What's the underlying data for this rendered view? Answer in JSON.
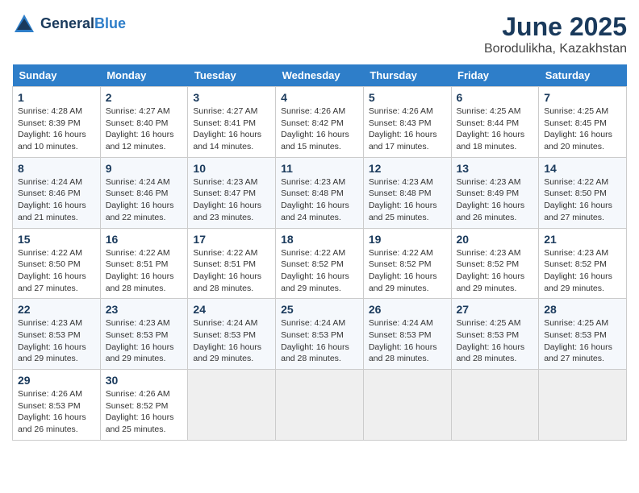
{
  "header": {
    "logo_line1": "General",
    "logo_line2": "Blue",
    "month_title": "June 2025",
    "location": "Borodulikha, Kazakhstan"
  },
  "weekdays": [
    "Sunday",
    "Monday",
    "Tuesday",
    "Wednesday",
    "Thursday",
    "Friday",
    "Saturday"
  ],
  "weeks": [
    [
      {
        "day": "1",
        "info": "Sunrise: 4:28 AM\nSunset: 8:39 PM\nDaylight: 16 hours\nand 10 minutes."
      },
      {
        "day": "2",
        "info": "Sunrise: 4:27 AM\nSunset: 8:40 PM\nDaylight: 16 hours\nand 12 minutes."
      },
      {
        "day": "3",
        "info": "Sunrise: 4:27 AM\nSunset: 8:41 PM\nDaylight: 16 hours\nand 14 minutes."
      },
      {
        "day": "4",
        "info": "Sunrise: 4:26 AM\nSunset: 8:42 PM\nDaylight: 16 hours\nand 15 minutes."
      },
      {
        "day": "5",
        "info": "Sunrise: 4:26 AM\nSunset: 8:43 PM\nDaylight: 16 hours\nand 17 minutes."
      },
      {
        "day": "6",
        "info": "Sunrise: 4:25 AM\nSunset: 8:44 PM\nDaylight: 16 hours\nand 18 minutes."
      },
      {
        "day": "7",
        "info": "Sunrise: 4:25 AM\nSunset: 8:45 PM\nDaylight: 16 hours\nand 20 minutes."
      }
    ],
    [
      {
        "day": "8",
        "info": "Sunrise: 4:24 AM\nSunset: 8:46 PM\nDaylight: 16 hours\nand 21 minutes."
      },
      {
        "day": "9",
        "info": "Sunrise: 4:24 AM\nSunset: 8:46 PM\nDaylight: 16 hours\nand 22 minutes."
      },
      {
        "day": "10",
        "info": "Sunrise: 4:23 AM\nSunset: 8:47 PM\nDaylight: 16 hours\nand 23 minutes."
      },
      {
        "day": "11",
        "info": "Sunrise: 4:23 AM\nSunset: 8:48 PM\nDaylight: 16 hours\nand 24 minutes."
      },
      {
        "day": "12",
        "info": "Sunrise: 4:23 AM\nSunset: 8:48 PM\nDaylight: 16 hours\nand 25 minutes."
      },
      {
        "day": "13",
        "info": "Sunrise: 4:23 AM\nSunset: 8:49 PM\nDaylight: 16 hours\nand 26 minutes."
      },
      {
        "day": "14",
        "info": "Sunrise: 4:22 AM\nSunset: 8:50 PM\nDaylight: 16 hours\nand 27 minutes."
      }
    ],
    [
      {
        "day": "15",
        "info": "Sunrise: 4:22 AM\nSunset: 8:50 PM\nDaylight: 16 hours\nand 27 minutes."
      },
      {
        "day": "16",
        "info": "Sunrise: 4:22 AM\nSunset: 8:51 PM\nDaylight: 16 hours\nand 28 minutes."
      },
      {
        "day": "17",
        "info": "Sunrise: 4:22 AM\nSunset: 8:51 PM\nDaylight: 16 hours\nand 28 minutes."
      },
      {
        "day": "18",
        "info": "Sunrise: 4:22 AM\nSunset: 8:52 PM\nDaylight: 16 hours\nand 29 minutes."
      },
      {
        "day": "19",
        "info": "Sunrise: 4:22 AM\nSunset: 8:52 PM\nDaylight: 16 hours\nand 29 minutes."
      },
      {
        "day": "20",
        "info": "Sunrise: 4:23 AM\nSunset: 8:52 PM\nDaylight: 16 hours\nand 29 minutes."
      },
      {
        "day": "21",
        "info": "Sunrise: 4:23 AM\nSunset: 8:52 PM\nDaylight: 16 hours\nand 29 minutes."
      }
    ],
    [
      {
        "day": "22",
        "info": "Sunrise: 4:23 AM\nSunset: 8:53 PM\nDaylight: 16 hours\nand 29 minutes."
      },
      {
        "day": "23",
        "info": "Sunrise: 4:23 AM\nSunset: 8:53 PM\nDaylight: 16 hours\nand 29 minutes."
      },
      {
        "day": "24",
        "info": "Sunrise: 4:24 AM\nSunset: 8:53 PM\nDaylight: 16 hours\nand 29 minutes."
      },
      {
        "day": "25",
        "info": "Sunrise: 4:24 AM\nSunset: 8:53 PM\nDaylight: 16 hours\nand 28 minutes."
      },
      {
        "day": "26",
        "info": "Sunrise: 4:24 AM\nSunset: 8:53 PM\nDaylight: 16 hours\nand 28 minutes."
      },
      {
        "day": "27",
        "info": "Sunrise: 4:25 AM\nSunset: 8:53 PM\nDaylight: 16 hours\nand 28 minutes."
      },
      {
        "day": "28",
        "info": "Sunrise: 4:25 AM\nSunset: 8:53 PM\nDaylight: 16 hours\nand 27 minutes."
      }
    ],
    [
      {
        "day": "29",
        "info": "Sunrise: 4:26 AM\nSunset: 8:53 PM\nDaylight: 16 hours\nand 26 minutes."
      },
      {
        "day": "30",
        "info": "Sunrise: 4:26 AM\nSunset: 8:52 PM\nDaylight: 16 hours\nand 25 minutes."
      },
      null,
      null,
      null,
      null,
      null
    ]
  ]
}
